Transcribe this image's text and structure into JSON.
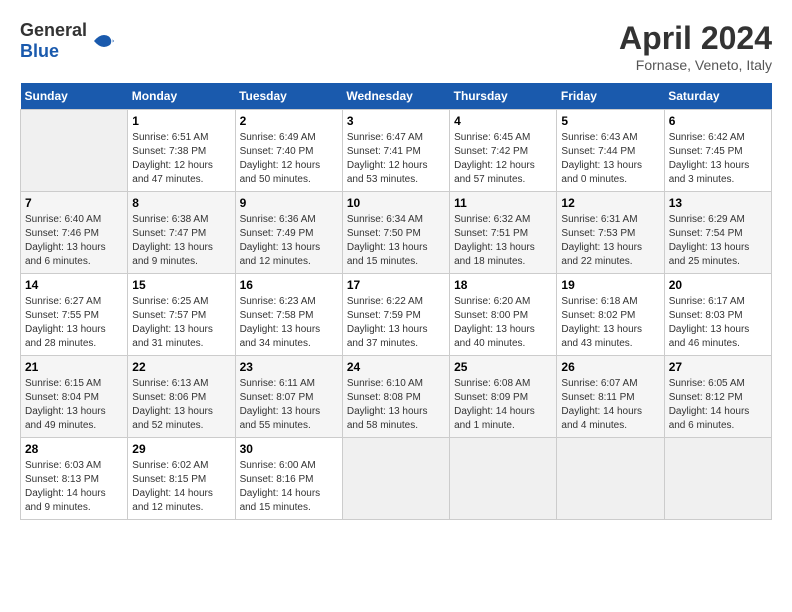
{
  "header": {
    "logo_general": "General",
    "logo_blue": "Blue",
    "title": "April 2024",
    "location": "Fornase, Veneto, Italy"
  },
  "weekdays": [
    "Sunday",
    "Monday",
    "Tuesday",
    "Wednesday",
    "Thursday",
    "Friday",
    "Saturday"
  ],
  "weeks": [
    [
      {
        "day": "",
        "sunrise": "",
        "sunset": "",
        "daylight": ""
      },
      {
        "day": "1",
        "sunrise": "Sunrise: 6:51 AM",
        "sunset": "Sunset: 7:38 PM",
        "daylight": "Daylight: 12 hours and 47 minutes."
      },
      {
        "day": "2",
        "sunrise": "Sunrise: 6:49 AM",
        "sunset": "Sunset: 7:40 PM",
        "daylight": "Daylight: 12 hours and 50 minutes."
      },
      {
        "day": "3",
        "sunrise": "Sunrise: 6:47 AM",
        "sunset": "Sunset: 7:41 PM",
        "daylight": "Daylight: 12 hours and 53 minutes."
      },
      {
        "day": "4",
        "sunrise": "Sunrise: 6:45 AM",
        "sunset": "Sunset: 7:42 PM",
        "daylight": "Daylight: 12 hours and 57 minutes."
      },
      {
        "day": "5",
        "sunrise": "Sunrise: 6:43 AM",
        "sunset": "Sunset: 7:44 PM",
        "daylight": "Daylight: 13 hours and 0 minutes."
      },
      {
        "day": "6",
        "sunrise": "Sunrise: 6:42 AM",
        "sunset": "Sunset: 7:45 PM",
        "daylight": "Daylight: 13 hours and 3 minutes."
      }
    ],
    [
      {
        "day": "7",
        "sunrise": "Sunrise: 6:40 AM",
        "sunset": "Sunset: 7:46 PM",
        "daylight": "Daylight: 13 hours and 6 minutes."
      },
      {
        "day": "8",
        "sunrise": "Sunrise: 6:38 AM",
        "sunset": "Sunset: 7:47 PM",
        "daylight": "Daylight: 13 hours and 9 minutes."
      },
      {
        "day": "9",
        "sunrise": "Sunrise: 6:36 AM",
        "sunset": "Sunset: 7:49 PM",
        "daylight": "Daylight: 13 hours and 12 minutes."
      },
      {
        "day": "10",
        "sunrise": "Sunrise: 6:34 AM",
        "sunset": "Sunset: 7:50 PM",
        "daylight": "Daylight: 13 hours and 15 minutes."
      },
      {
        "day": "11",
        "sunrise": "Sunrise: 6:32 AM",
        "sunset": "Sunset: 7:51 PM",
        "daylight": "Daylight: 13 hours and 18 minutes."
      },
      {
        "day": "12",
        "sunrise": "Sunrise: 6:31 AM",
        "sunset": "Sunset: 7:53 PM",
        "daylight": "Daylight: 13 hours and 22 minutes."
      },
      {
        "day": "13",
        "sunrise": "Sunrise: 6:29 AM",
        "sunset": "Sunset: 7:54 PM",
        "daylight": "Daylight: 13 hours and 25 minutes."
      }
    ],
    [
      {
        "day": "14",
        "sunrise": "Sunrise: 6:27 AM",
        "sunset": "Sunset: 7:55 PM",
        "daylight": "Daylight: 13 hours and 28 minutes."
      },
      {
        "day": "15",
        "sunrise": "Sunrise: 6:25 AM",
        "sunset": "Sunset: 7:57 PM",
        "daylight": "Daylight: 13 hours and 31 minutes."
      },
      {
        "day": "16",
        "sunrise": "Sunrise: 6:23 AM",
        "sunset": "Sunset: 7:58 PM",
        "daylight": "Daylight: 13 hours and 34 minutes."
      },
      {
        "day": "17",
        "sunrise": "Sunrise: 6:22 AM",
        "sunset": "Sunset: 7:59 PM",
        "daylight": "Daylight: 13 hours and 37 minutes."
      },
      {
        "day": "18",
        "sunrise": "Sunrise: 6:20 AM",
        "sunset": "Sunset: 8:00 PM",
        "daylight": "Daylight: 13 hours and 40 minutes."
      },
      {
        "day": "19",
        "sunrise": "Sunrise: 6:18 AM",
        "sunset": "Sunset: 8:02 PM",
        "daylight": "Daylight: 13 hours and 43 minutes."
      },
      {
        "day": "20",
        "sunrise": "Sunrise: 6:17 AM",
        "sunset": "Sunset: 8:03 PM",
        "daylight": "Daylight: 13 hours and 46 minutes."
      }
    ],
    [
      {
        "day": "21",
        "sunrise": "Sunrise: 6:15 AM",
        "sunset": "Sunset: 8:04 PM",
        "daylight": "Daylight: 13 hours and 49 minutes."
      },
      {
        "day": "22",
        "sunrise": "Sunrise: 6:13 AM",
        "sunset": "Sunset: 8:06 PM",
        "daylight": "Daylight: 13 hours and 52 minutes."
      },
      {
        "day": "23",
        "sunrise": "Sunrise: 6:11 AM",
        "sunset": "Sunset: 8:07 PM",
        "daylight": "Daylight: 13 hours and 55 minutes."
      },
      {
        "day": "24",
        "sunrise": "Sunrise: 6:10 AM",
        "sunset": "Sunset: 8:08 PM",
        "daylight": "Daylight: 13 hours and 58 minutes."
      },
      {
        "day": "25",
        "sunrise": "Sunrise: 6:08 AM",
        "sunset": "Sunset: 8:09 PM",
        "daylight": "Daylight: 14 hours and 1 minute."
      },
      {
        "day": "26",
        "sunrise": "Sunrise: 6:07 AM",
        "sunset": "Sunset: 8:11 PM",
        "daylight": "Daylight: 14 hours and 4 minutes."
      },
      {
        "day": "27",
        "sunrise": "Sunrise: 6:05 AM",
        "sunset": "Sunset: 8:12 PM",
        "daylight": "Daylight: 14 hours and 6 minutes."
      }
    ],
    [
      {
        "day": "28",
        "sunrise": "Sunrise: 6:03 AM",
        "sunset": "Sunset: 8:13 PM",
        "daylight": "Daylight: 14 hours and 9 minutes."
      },
      {
        "day": "29",
        "sunrise": "Sunrise: 6:02 AM",
        "sunset": "Sunset: 8:15 PM",
        "daylight": "Daylight: 14 hours and 12 minutes."
      },
      {
        "day": "30",
        "sunrise": "Sunrise: 6:00 AM",
        "sunset": "Sunset: 8:16 PM",
        "daylight": "Daylight: 14 hours and 15 minutes."
      },
      {
        "day": "",
        "sunrise": "",
        "sunset": "",
        "daylight": ""
      },
      {
        "day": "",
        "sunrise": "",
        "sunset": "",
        "daylight": ""
      },
      {
        "day": "",
        "sunrise": "",
        "sunset": "",
        "daylight": ""
      },
      {
        "day": "",
        "sunrise": "",
        "sunset": "",
        "daylight": ""
      }
    ]
  ]
}
